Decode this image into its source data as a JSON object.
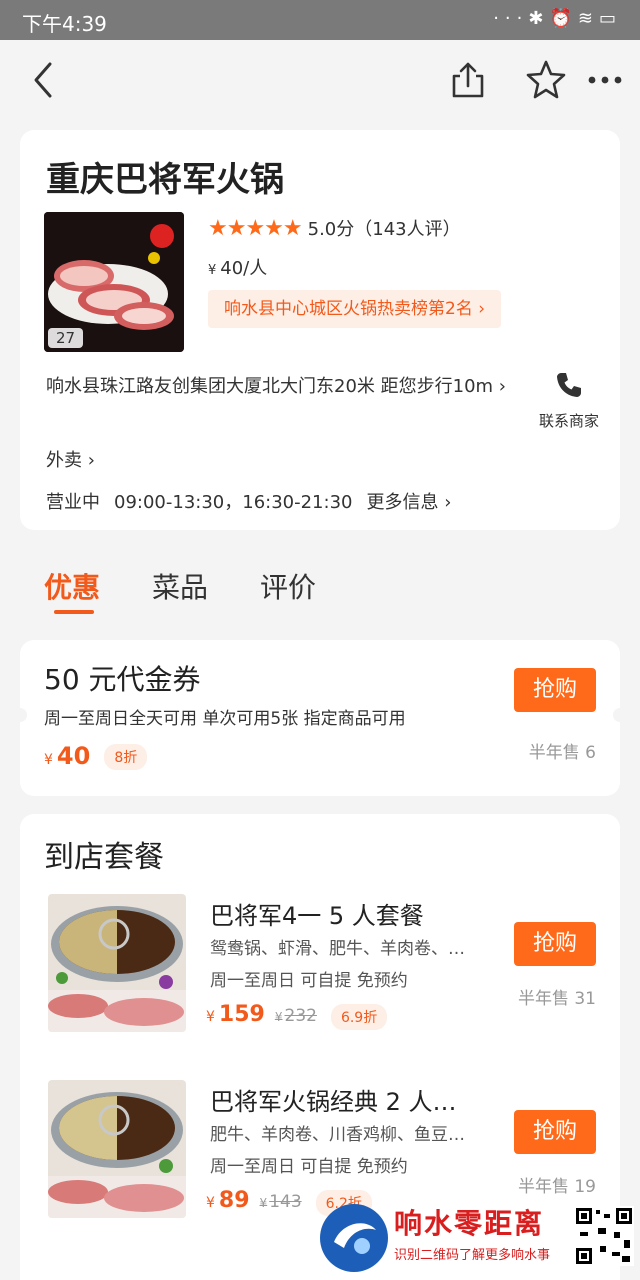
{
  "status_bar": {
    "time": "下午4:39",
    "icons": [
      "signal-dots-icon",
      "bluetooth-icon",
      "alarm-icon",
      "hd-signal-icon",
      "wifi-icon",
      "battery-icon"
    ]
  },
  "nav": {
    "icons": [
      "back-icon",
      "share-icon",
      "star-outline-icon",
      "more-icon"
    ]
  },
  "shop": {
    "name": "重庆巴将军火锅",
    "photo_count": "27",
    "stars": "★★★★★",
    "rating": "5.0分（143人评）",
    "price_symbol": "¥",
    "price": "40/人",
    "rank": "响水县中心城区火锅热卖榜第2名 ›",
    "address": "响水县珠江路友创集团大厦北大门东20米 距您步行10m ›",
    "contact_label": "联系商家",
    "delivery": "外卖 ›",
    "hours_status": "营业中",
    "hours": "09:00-13:30，16:30-21:30",
    "more_info": "更多信息 ›"
  },
  "tabs": [
    "优惠",
    "菜品",
    "评价"
  ],
  "voucher": {
    "title": "50 元代金券",
    "desc": "周一至周日全天可用  单次可用5张  指定商品可用",
    "yen": "¥",
    "price": "40",
    "discount": "8折",
    "buy_label": "抢购",
    "sold": "半年售 6"
  },
  "packages_section": {
    "title": "到店套餐",
    "items": [
      {
        "name": "巴将军4一 5 人套餐",
        "items": "鸳鸯锅、虾滑、肥牛、羊肉卷、…",
        "terms": "周一至周日  可自提  免预约",
        "yen": "¥",
        "price": "159",
        "orig_yen": "¥",
        "original": "232",
        "discount": "6.9折",
        "buy_label": "抢购",
        "sold": "半年售 31"
      },
      {
        "name": "巴将军火锅经典 2 人…",
        "items": "肥牛、羊肉卷、川香鸡柳、鱼豆…",
        "terms": "周一至周日  可自提  免预约",
        "yen": "¥",
        "price": "89",
        "orig_yen": "¥",
        "original": "143",
        "discount": "6.2折",
        "buy_label": "抢购",
        "sold": "半年售 19"
      }
    ]
  },
  "watermark": {
    "name": "响水零距离",
    "sub": "识别二维码了解更多响水事"
  },
  "colors": {
    "accent": "#f25a1b",
    "button": "#ff6a1a",
    "badge_bg": "#fdeee6",
    "watermark_red": "#d81e1e"
  }
}
